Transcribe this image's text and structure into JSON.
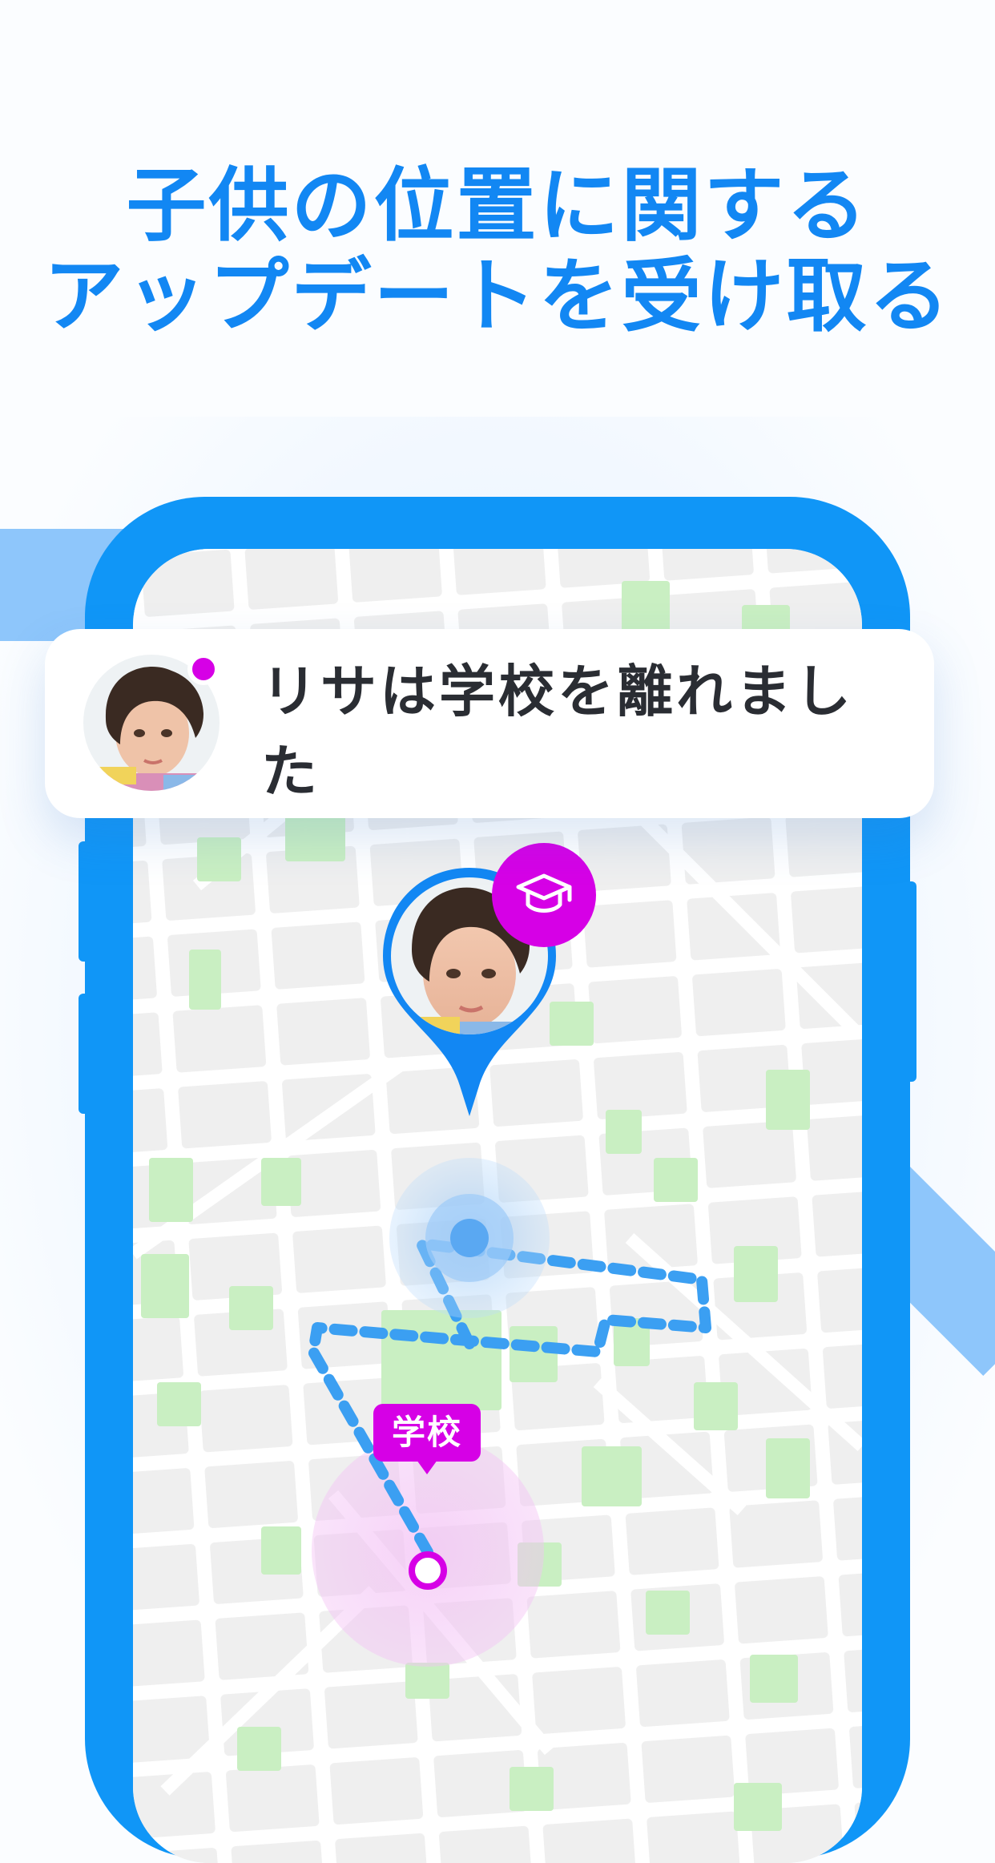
{
  "headline": {
    "line1": "子供の位置に関する",
    "line2": "アップデートを受け取る"
  },
  "notification": {
    "message": "リサは学校を離れました",
    "avatar": "child-avatar",
    "status_dot_color": "#d600e6"
  },
  "map": {
    "child_pin": {
      "avatar": "child-avatar",
      "badge_icon": "graduation-cap-icon",
      "pin_color": "#1287f3",
      "badge_color": "#d600e6"
    },
    "school_marker": {
      "label": "学校",
      "color": "#d600e6"
    },
    "route_color": "#3b9ff2"
  },
  "colors": {
    "brand_blue": "#1287f3",
    "phone_frame": "#1096f7",
    "accent_magenta": "#d600e6",
    "park_green": "#c9efc2",
    "road_white": "#ffffff",
    "block_gray": "#efefef"
  }
}
